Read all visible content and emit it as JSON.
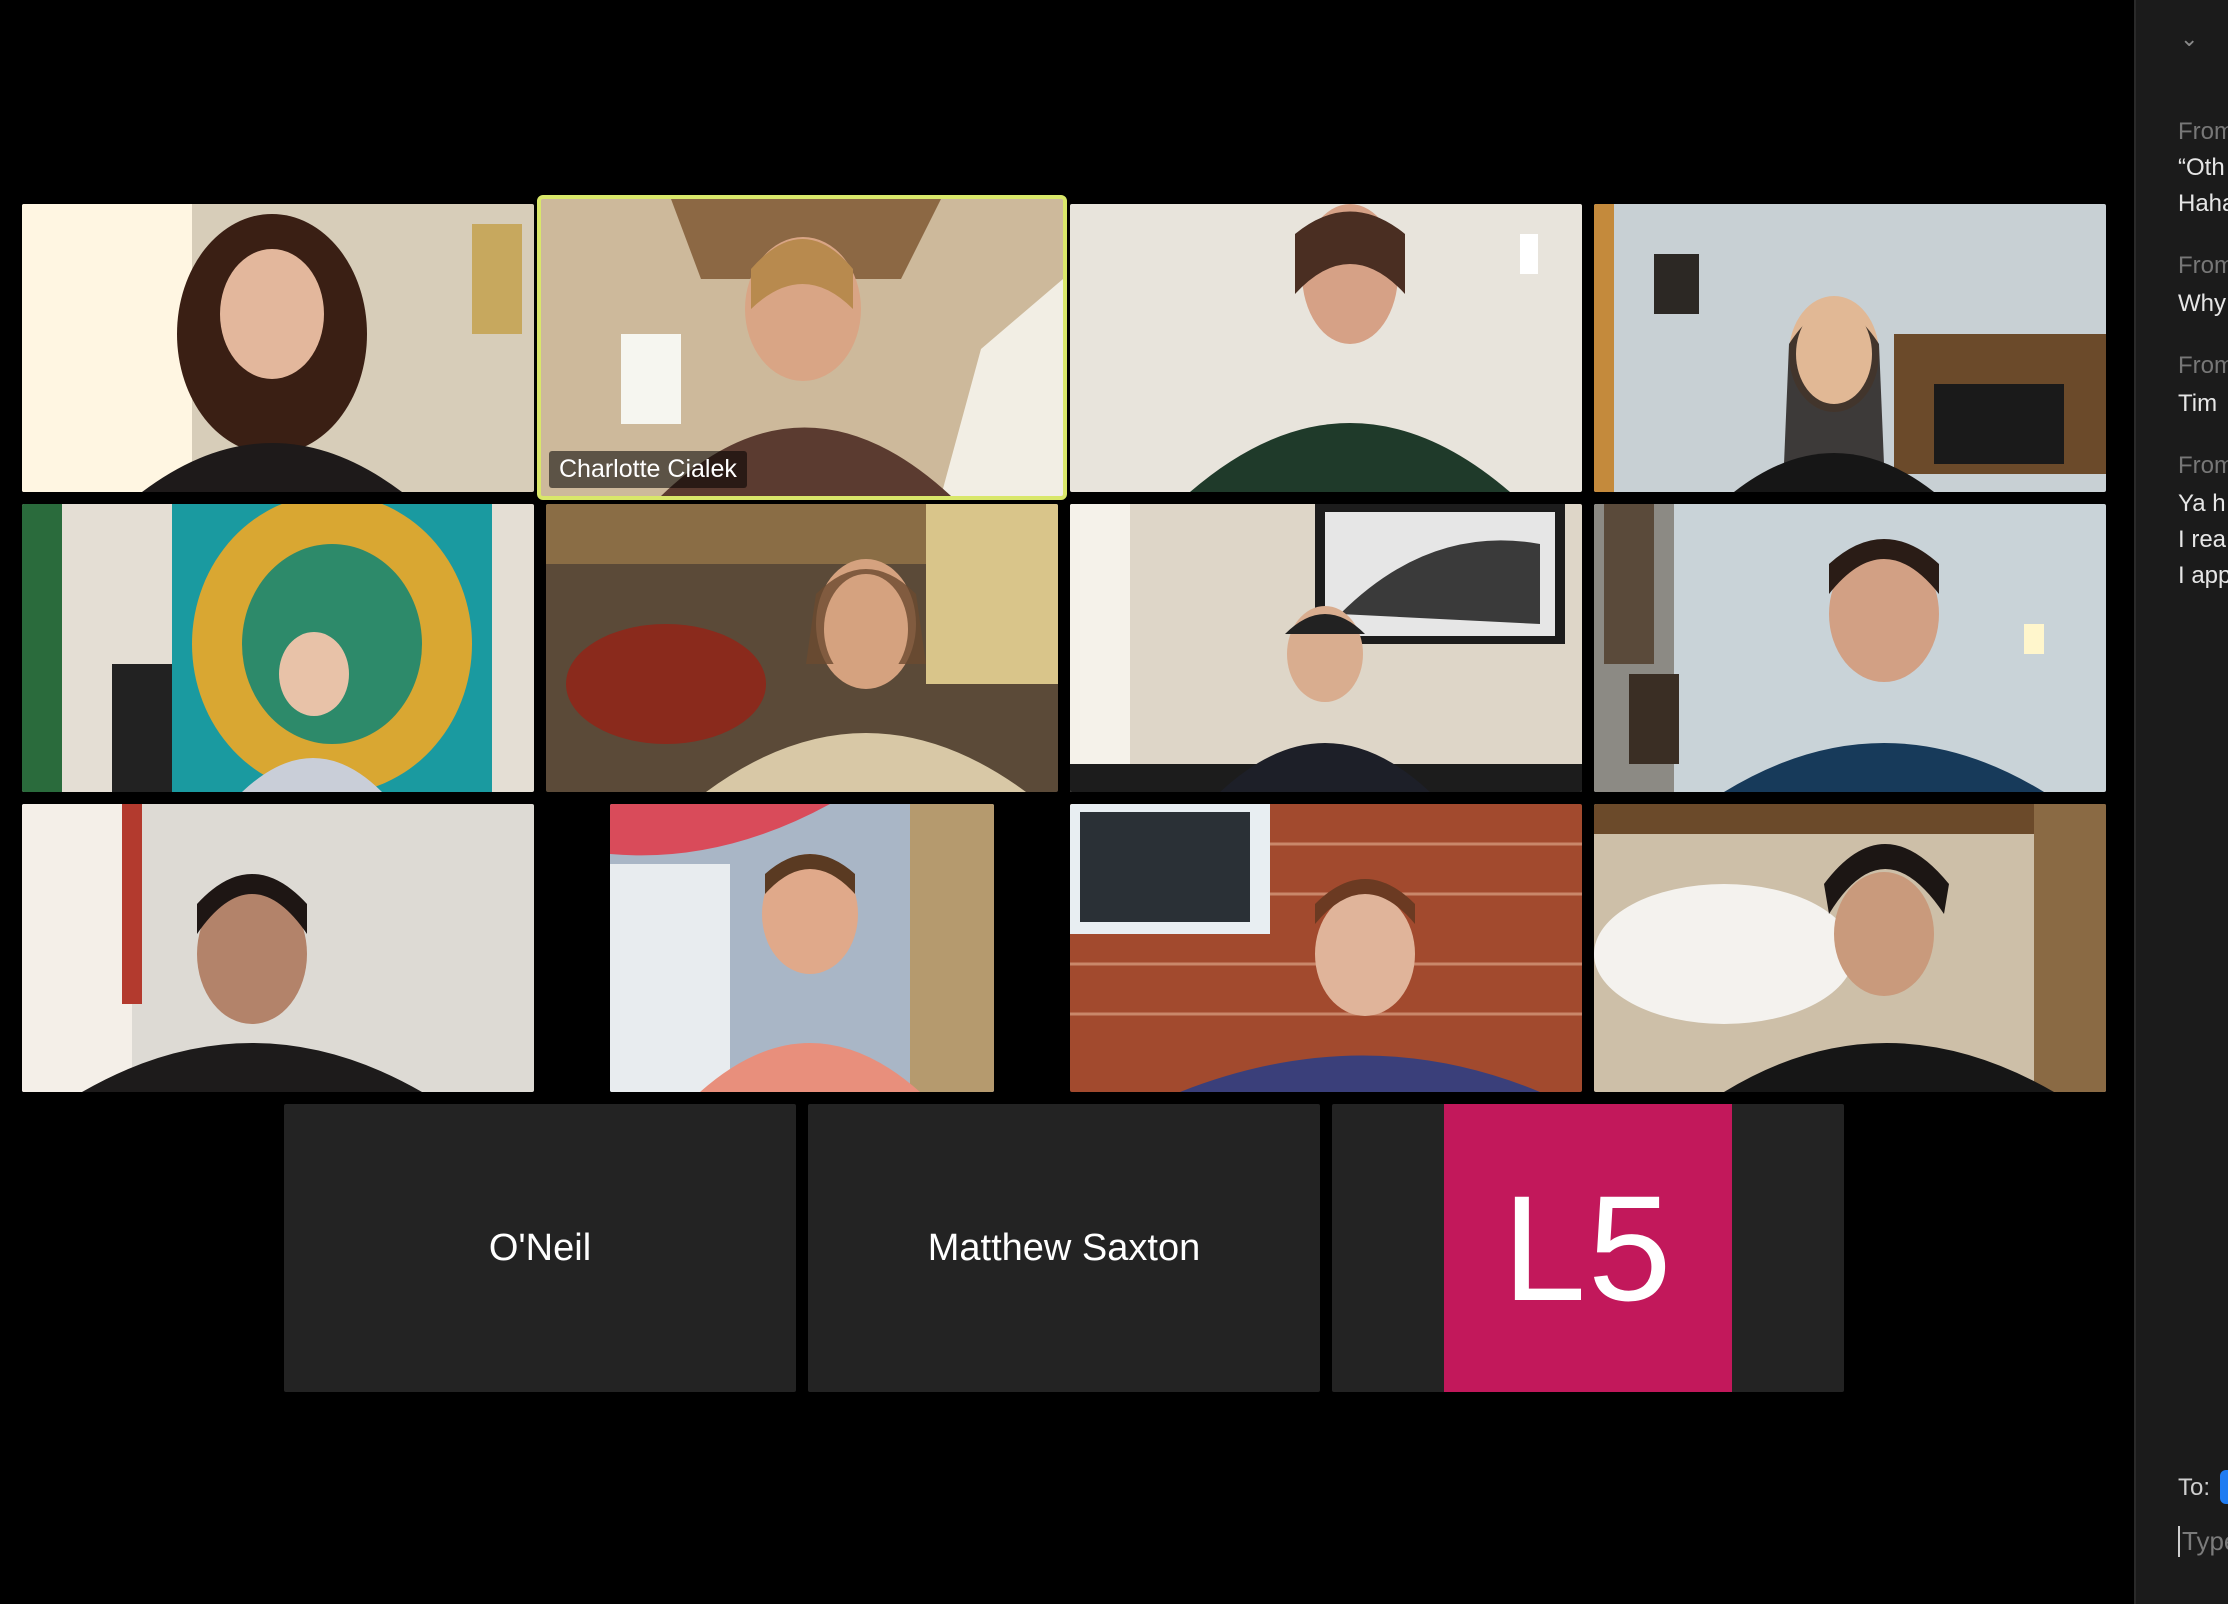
{
  "meeting": {
    "speaker_name": "Charlotte Cialek",
    "name_only_tiles": [
      "O'Neil",
      "Matthew Saxton"
    ],
    "avatar_initials": "L5",
    "avatar_color": "#c2185b",
    "active_speaker_color": "#d9e76a"
  },
  "chat": {
    "collapse_icon": "chevron-down-icon",
    "messages": [
      {
        "from": "From",
        "lines": [
          "“Oth",
          "Haha"
        ]
      },
      {
        "from": "From",
        "lines": [
          "Why"
        ]
      },
      {
        "from": "From",
        "lines": [
          "Tim"
        ]
      },
      {
        "from": "From",
        "lines": [
          "Ya h",
          "I rea",
          "I app"
        ]
      }
    ],
    "to_label": "To:",
    "input_placeholder": "Type"
  }
}
